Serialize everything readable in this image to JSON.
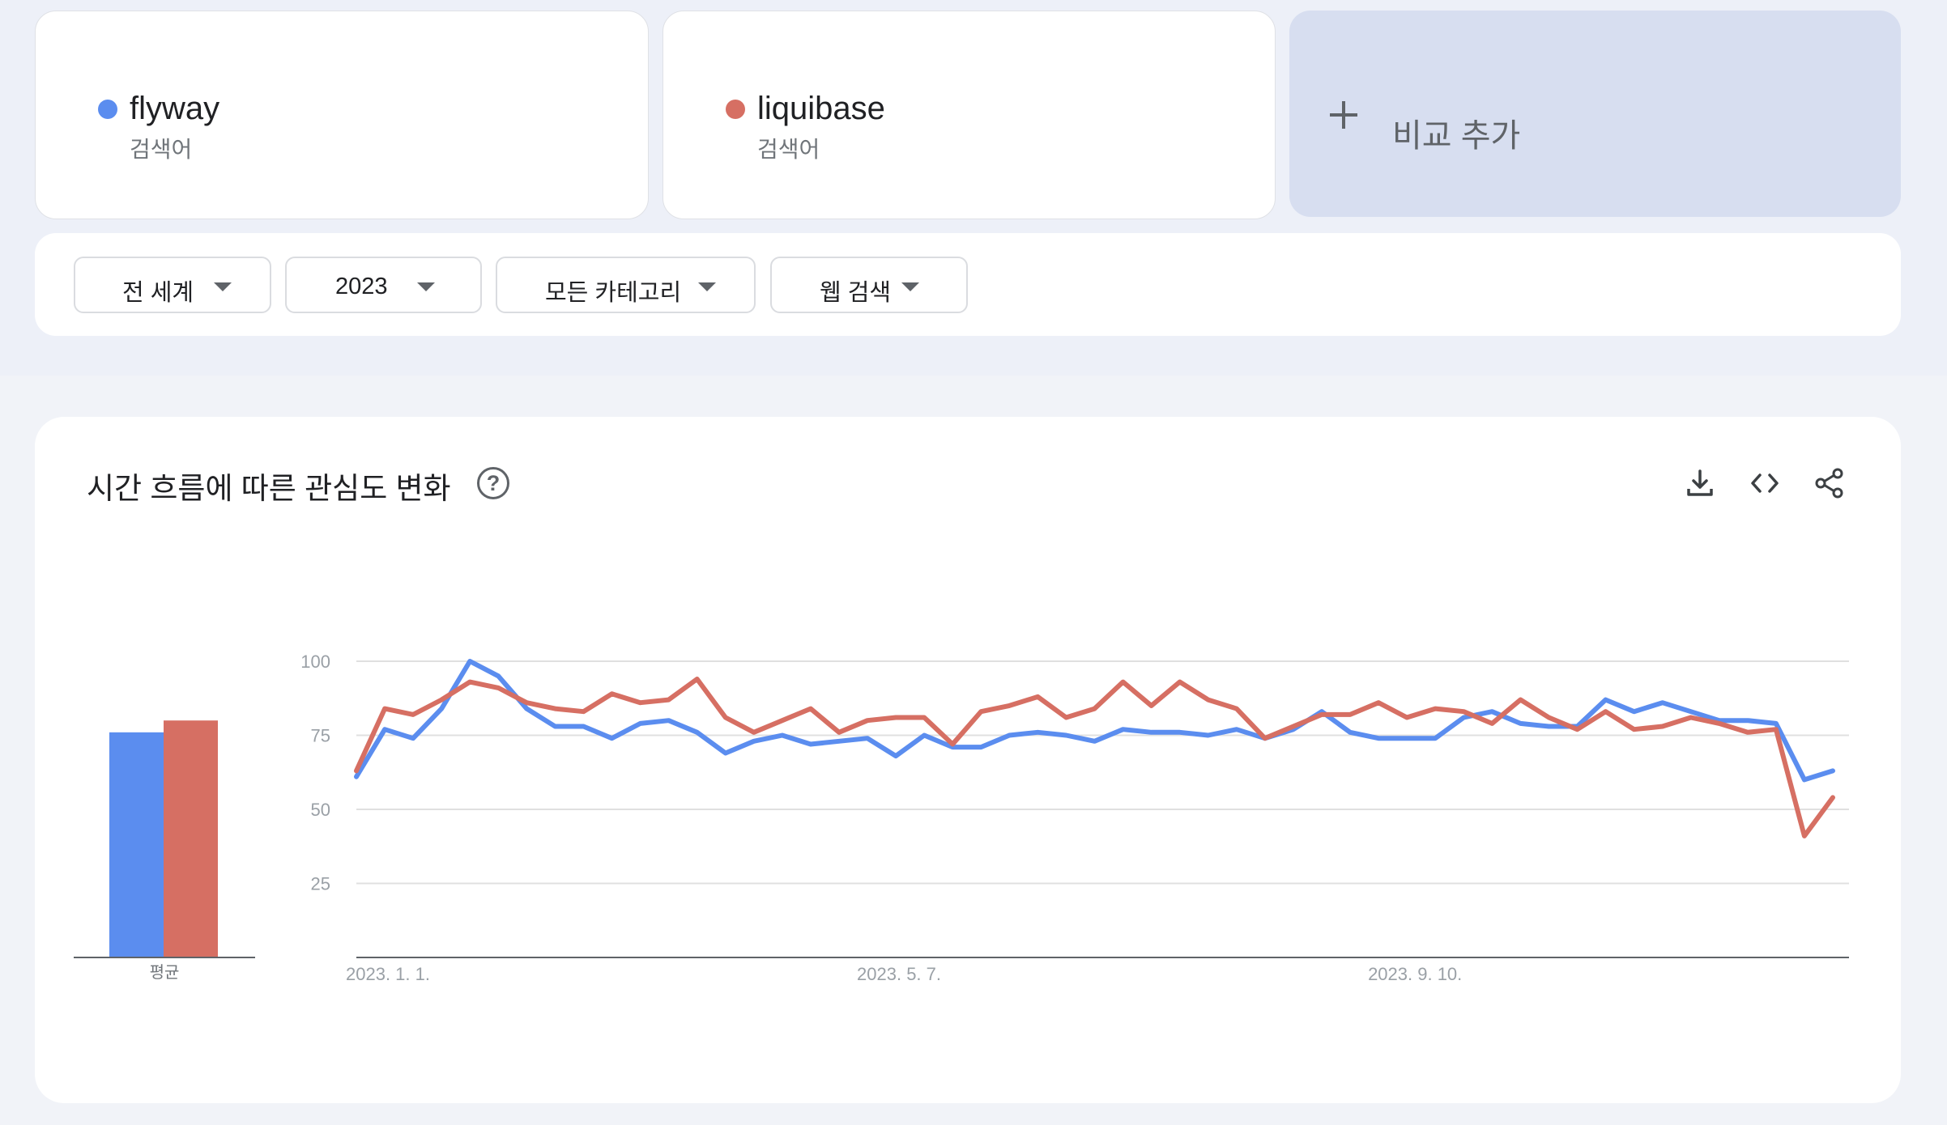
{
  "terms": [
    {
      "name": "flyway",
      "type": "검색어",
      "color": "#5b8def"
    },
    {
      "name": "liquibase",
      "type": "검색어",
      "color": "#d66f63"
    }
  ],
  "add_compare": {
    "label": "비교 추가",
    "icon": "plus-icon"
  },
  "filters": {
    "region": "전 세계",
    "period": "2023",
    "category": "모든 카테고리",
    "search_type": "웹 검색"
  },
  "chart_panel": {
    "title": "시간 흐름에 따른 관심도 변화",
    "help_icon": "question-circle-icon",
    "tools": [
      "download-icon",
      "embed-code-icon",
      "share-icon"
    ],
    "avg_label": "평균"
  },
  "chart_data": {
    "type": "line",
    "ylim": [
      0,
      100
    ],
    "yticks": [
      25,
      50,
      75,
      100
    ],
    "grid": true,
    "x_tick_labels": [
      "2023. 1. 1.",
      "2023. 5. 7.",
      "2023. 9. 10."
    ],
    "x_tick_index": [
      0,
      18,
      36
    ],
    "averages": [
      {
        "name": "flyway",
        "value": 76
      },
      {
        "name": "liquibase",
        "value": 80
      }
    ],
    "series": [
      {
        "name": "flyway",
        "color": "#5b8def",
        "values": [
          61,
          77,
          74,
          84,
          100,
          95,
          84,
          78,
          78,
          74,
          79,
          80,
          76,
          69,
          73,
          75,
          72,
          73,
          74,
          68,
          75,
          71,
          71,
          75,
          76,
          75,
          73,
          77,
          76,
          76,
          75,
          77,
          74,
          77,
          83,
          76,
          74,
          74,
          74,
          81,
          83,
          79,
          78,
          78,
          87,
          83,
          86,
          83,
          80,
          80,
          79,
          60,
          63
        ]
      },
      {
        "name": "liquibase",
        "color": "#d66f63",
        "values": [
          63,
          84,
          82,
          87,
          93,
          91,
          86,
          84,
          83,
          89,
          86,
          87,
          94,
          81,
          76,
          80,
          84,
          76,
          80,
          81,
          81,
          72,
          83,
          85,
          88,
          81,
          84,
          93,
          85,
          93,
          87,
          84,
          74,
          78,
          82,
          82,
          86,
          81,
          84,
          83,
          79,
          87,
          81,
          77,
          83,
          77,
          78,
          81,
          79,
          76,
          77,
          41,
          54
        ]
      }
    ]
  }
}
